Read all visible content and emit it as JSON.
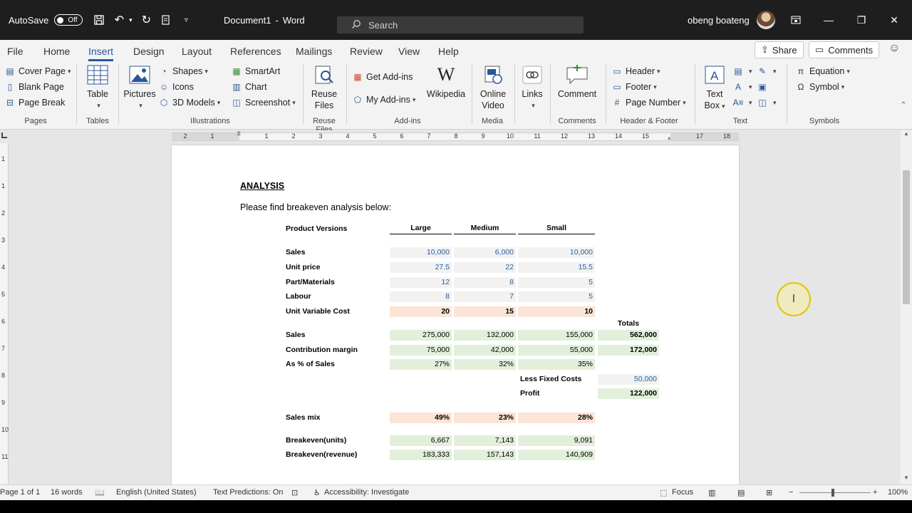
{
  "titlebar": {
    "autosave_label": "AutoSave",
    "autosave_state": "Off",
    "doc_title": "Document1",
    "app_name": "Word",
    "search_placeholder": "Search",
    "user_name": "obeng boateng"
  },
  "tabs": [
    "File",
    "Home",
    "Insert",
    "Design",
    "Layout",
    "References",
    "Mailings",
    "Review",
    "View",
    "Help"
  ],
  "active_tab": "Insert",
  "share_label": "Share",
  "comments_label": "Comments",
  "ribbon": {
    "pages": {
      "label": "Pages",
      "items": [
        "Cover Page",
        "Blank Page",
        "Page Break"
      ]
    },
    "tables": {
      "label": "Tables",
      "table": "Table"
    },
    "illustrations": {
      "label": "Illustrations",
      "pictures": "Pictures",
      "shapes": "Shapes",
      "icons": "Icons",
      "models": "3D Models",
      "smartart": "SmartArt",
      "chart": "Chart",
      "screenshot": "Screenshot"
    },
    "reuse": {
      "label": "Reuse Files",
      "button_l1": "Reuse",
      "button_l2": "Files"
    },
    "addins": {
      "label": "Add-ins",
      "get": "Get Add-ins",
      "my": "My Add-ins",
      "wikipedia": "Wikipedia"
    },
    "media": {
      "label": "Media",
      "l1": "Online",
      "l2": "Video"
    },
    "links": {
      "label": "Links"
    },
    "comments": {
      "label": "Comments",
      "comment": "Comment"
    },
    "header_footer": {
      "label": "Header & Footer",
      "header": "Header",
      "footer": "Footer",
      "page_number": "Page Number"
    },
    "text": {
      "label": "Text",
      "textbox_l1": "Text",
      "textbox_l2": "Box"
    },
    "symbols": {
      "label": "Symbols",
      "equation": "Equation",
      "symbol": "Symbol"
    }
  },
  "ruler": {
    "h_numbers": [
      "2",
      "1",
      "1",
      "2",
      "3",
      "4",
      "5",
      "6",
      "7",
      "8",
      "9",
      "10",
      "11",
      "12",
      "13",
      "14",
      "15",
      "17",
      "18"
    ],
    "v_numbers": [
      "1",
      "1",
      "2",
      "3",
      "4",
      "5",
      "6",
      "7",
      "8",
      "9",
      "10",
      "11"
    ]
  },
  "document": {
    "heading": "ANALYSIS",
    "intro": "Please find breakeven analysis below:",
    "columns": [
      "Product Versions",
      "Large",
      "Medium",
      "Small"
    ],
    "totals_label": "Totals",
    "rows_input": [
      {
        "label": "Sales",
        "values": [
          "10,000",
          "6,000",
          "10,000"
        ]
      },
      {
        "label": "Unit price",
        "values": [
          "27.5",
          "22",
          "15.5"
        ]
      },
      {
        "label": "Part/Materials",
        "values": [
          "12",
          "8",
          "5"
        ]
      },
      {
        "label": "Labour",
        "values": [
          "8",
          "7",
          "5"
        ]
      }
    ],
    "row_uvc": {
      "label": "Unit Variable Cost",
      "values": [
        "20",
        "15",
        "10"
      ]
    },
    "row_sales": {
      "label": "Sales",
      "values": [
        "275,000",
        "132,000",
        "155,000"
      ],
      "total": "562,000"
    },
    "row_cm": {
      "label": "Contribution margin",
      "values": [
        "75,000",
        "42,000",
        "55,000"
      ],
      "total": "172,000"
    },
    "row_pct": {
      "label": "As % of Sales",
      "values": [
        "27%",
        "32%",
        "35%"
      ]
    },
    "fixed_costs": {
      "label": "Less Fixed Costs",
      "value": "50,000"
    },
    "profit": {
      "label": "Profit",
      "value": "122,000"
    },
    "row_mix": {
      "label": "Sales mix",
      "values": [
        "49%",
        "23%",
        "28%"
      ]
    },
    "row_be_units": {
      "label": "Breakeven(units)",
      "values": [
        "6,667",
        "7,143",
        "9,091"
      ]
    },
    "row_be_rev": {
      "label": "Breakeven(revenue)",
      "values": [
        "183,333",
        "157,143",
        "140,909"
      ]
    }
  },
  "statusbar": {
    "page": "Page 1 of 1",
    "words": "16 words",
    "language": "English (United States)",
    "predictions": "Text Predictions: On",
    "accessibility": "Accessibility: Investigate",
    "focus": "Focus",
    "zoom": "100%"
  }
}
